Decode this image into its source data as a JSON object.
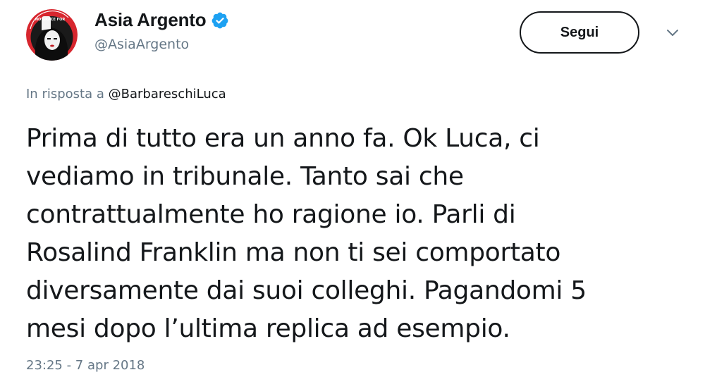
{
  "author": {
    "display_name": "Asia Argento",
    "handle": "@AsiaArgento",
    "verified": true,
    "avatar_icon": "profile-photo-avatar",
    "avatar_badge_text": "NO GRACE FOR"
  },
  "actions": {
    "follow_label": "Segui",
    "more_icon": "chevron-down-icon"
  },
  "reply_context": {
    "prefix": "In risposta a",
    "mention": "@BarbareschiLuca"
  },
  "tweet": {
    "lines": [
      "Prima di tutto era un anno fa. Ok Luca, ci",
      "vediamo in tribunale. Tanto sai che",
      "contrattualmente ho ragione io. Parli di",
      "Rosalind Franklin ma non ti sei comportato",
      "diversamente dai suoi colleghi. Pagandomi 5",
      "mesi dopo l’ultima replica ad esempio."
    ]
  },
  "timestamp": "23:25 - 7 apr 2018",
  "colors": {
    "text_primary": "#14171a",
    "text_secondary": "#657786",
    "verified_blue": "#1da1f2",
    "avatar_red": "#d7262e"
  }
}
